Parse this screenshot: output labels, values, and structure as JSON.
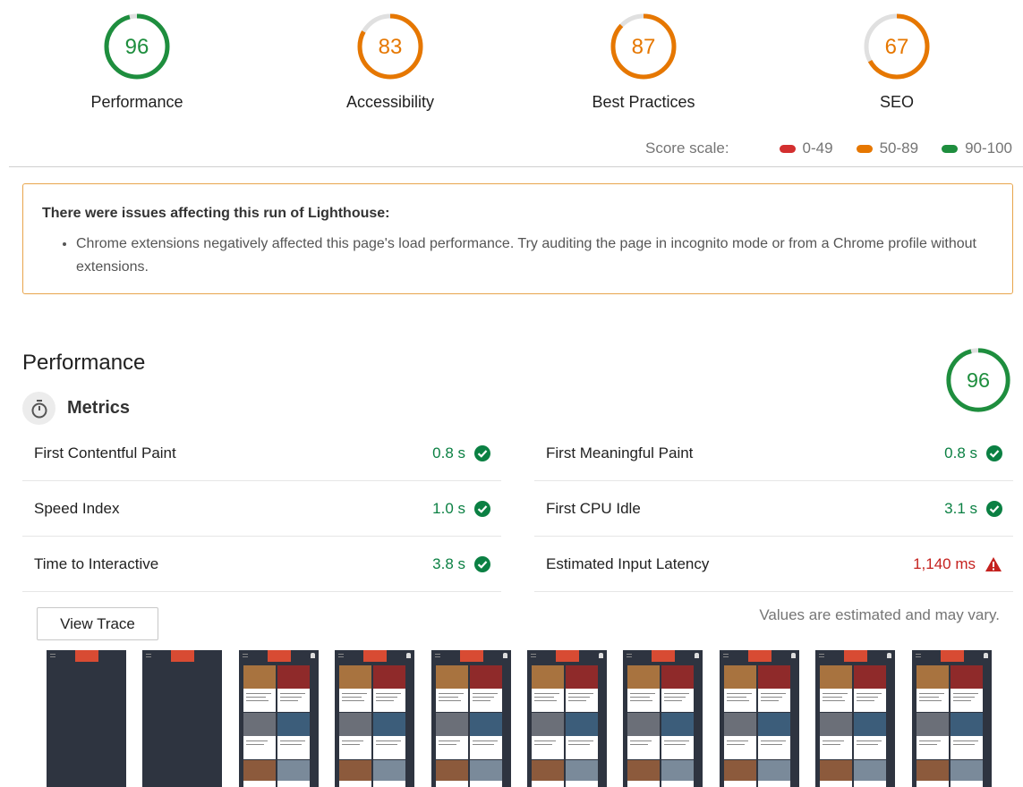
{
  "categories": [
    {
      "id": "performance",
      "label": "Performance",
      "score": "96",
      "value": 96,
      "color": "#1e8e3e"
    },
    {
      "id": "accessibility",
      "label": "Accessibility",
      "score": "83",
      "value": 83,
      "color": "#e67700"
    },
    {
      "id": "best-practices",
      "label": "Best Practices",
      "score": "87",
      "value": 87,
      "color": "#e67700"
    },
    {
      "id": "seo",
      "label": "SEO",
      "score": "67",
      "value": 67,
      "color": "#e67700"
    }
  ],
  "score_scale": {
    "title": "Score scale:",
    "ranges": [
      {
        "label": "0-49",
        "color": "#d32f2f"
      },
      {
        "label": "50-89",
        "color": "#e67700"
      },
      {
        "label": "90-100",
        "color": "#1e8e3e"
      }
    ]
  },
  "warning": {
    "title": "There were issues affecting this run of Lighthouse:",
    "items": [
      "Chrome extensions negatively affected this page's load performance. Try auditing the page in incognito mode or from a Chrome profile without extensions."
    ]
  },
  "performance": {
    "title": "Performance",
    "score": "96",
    "value": 96,
    "metrics_title": "Metrics",
    "metrics_left": [
      {
        "name": "First Contentful Paint",
        "value": "0.8 s",
        "status": "pass"
      },
      {
        "name": "Speed Index",
        "value": "1.0 s",
        "status": "pass"
      },
      {
        "name": "Time to Interactive",
        "value": "3.8 s",
        "status": "pass"
      }
    ],
    "metrics_right": [
      {
        "name": "First Meaningful Paint",
        "value": "0.8 s",
        "status": "pass"
      },
      {
        "name": "First CPU Idle",
        "value": "3.1 s",
        "status": "pass"
      },
      {
        "name": "Estimated Input Latency",
        "value": "1,140 ms",
        "status": "fail"
      }
    ],
    "view_trace_label": "View Trace",
    "estimate_note": "Values are estimated and may vary."
  },
  "filmstrip": {
    "frames": [
      "empty",
      "empty",
      "loaded",
      "loaded",
      "loaded",
      "loaded",
      "loaded",
      "loaded",
      "loaded",
      "loaded"
    ]
  },
  "colors": {
    "pass": "#0b8043",
    "fail": "#c5221f",
    "average": "#e67700",
    "track": "#e0e0e0"
  }
}
